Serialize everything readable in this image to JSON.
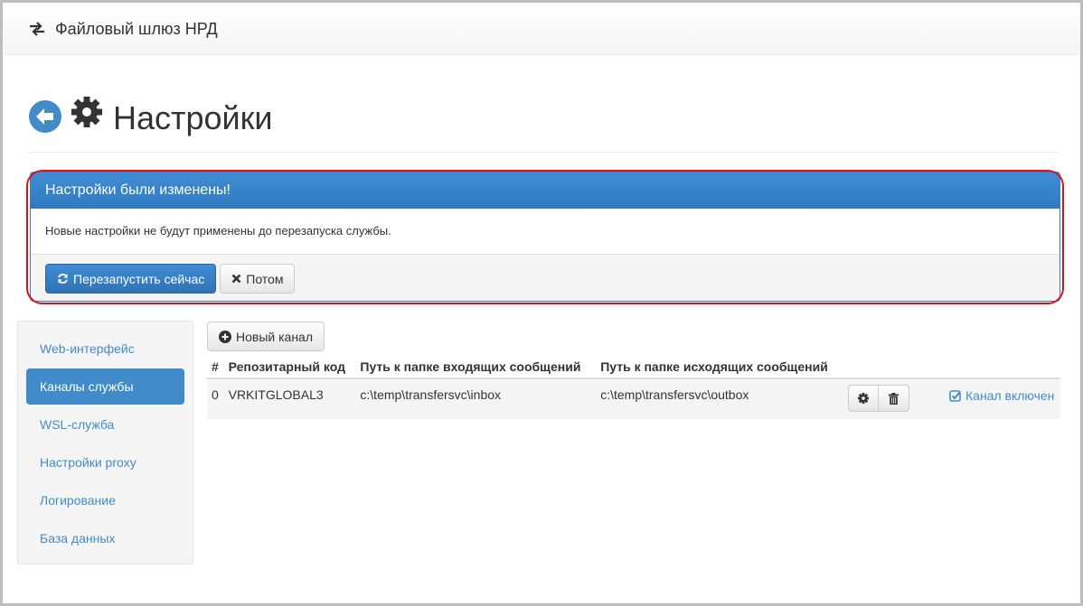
{
  "navbar": {
    "brand": "Файловый шлюз НРД",
    "brand_icon": "exchange-arrows-icon"
  },
  "header": {
    "title": "Настройки",
    "back_icon": "arrow-left-circle-icon",
    "title_icon": "gear-icon"
  },
  "alert": {
    "heading": "Настройки были изменены!",
    "body": "Новые настройки не будут применены до перезапуска службы.",
    "restart_label": "Перезапустить сейчас",
    "later_label": "Потом"
  },
  "sidebar": {
    "items": [
      {
        "label": "Web-интерфейс",
        "active": false
      },
      {
        "label": "Каналы службы",
        "active": true
      },
      {
        "label": "WSL-служба",
        "active": false
      },
      {
        "label": "Настройки proxy",
        "active": false
      },
      {
        "label": "Логирование",
        "active": false
      },
      {
        "label": "База данных",
        "active": false
      }
    ]
  },
  "main": {
    "new_channel_label": "Новый канал",
    "table": {
      "headers": [
        "#",
        "Репозитарный код",
        "Путь к папке входящих сообщений",
        "Путь к папке исходящих сообщений"
      ],
      "rows": [
        {
          "index": "0",
          "code": "VRKITGLOBAL3",
          "inbox": "c:\\temp\\transfersvc\\inbox",
          "outbox": "c:\\temp\\transfersvc\\outbox",
          "status": "Канал включен"
        }
      ]
    }
  },
  "colors": {
    "primary": "#428bca",
    "highlight": "#e0101a"
  }
}
